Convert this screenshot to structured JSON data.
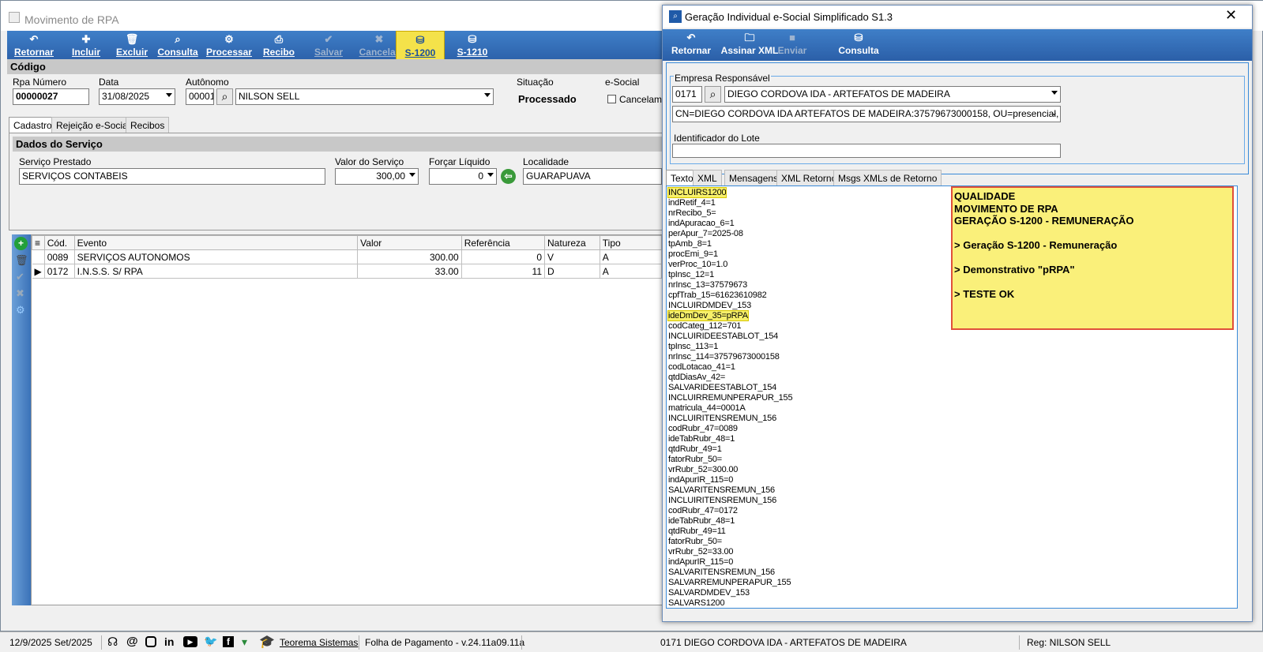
{
  "main": {
    "title": "Movimento de RPA",
    "toolbar": [
      {
        "label": "Retornar",
        "icon": "↶",
        "state": "enabled"
      },
      {
        "label": "Incluir",
        "icon": "✚",
        "state": "enabled"
      },
      {
        "label": "Excluir",
        "icon": "🗑",
        "state": "enabled"
      },
      {
        "label": "Consulta",
        "icon": "⌕",
        "state": "enabled"
      },
      {
        "label": "Processar",
        "icon": "⚙",
        "state": "enabled"
      },
      {
        "label": "Recibo",
        "icon": "⎙",
        "state": "enabled"
      },
      {
        "label": "Salvar",
        "icon": "✔",
        "state": "disabled"
      },
      {
        "label": "Cancelar",
        "icon": "✖",
        "state": "disabled"
      },
      {
        "label": "S-1200",
        "icon": "⛁",
        "state": "highlighted"
      },
      {
        "label": "S-1210",
        "icon": "⛁",
        "state": "enabled"
      }
    ],
    "codigo_section": "Código",
    "rpa_numero_label": "Rpa Número",
    "rpa_numero": "00000027",
    "data_label": "Data",
    "data": "31/08/2025",
    "autonomo_label": "Autônomo",
    "autonomo_code": "00001",
    "autonomo_name": "NILSON SELL",
    "situacao_label": "Situação",
    "situacao": "Processado",
    "esocial_label": "e-Social",
    "cancelamento_label": "Cancelame",
    "tabs": [
      "Cadastro",
      "Rejeição e-Social",
      "Recibos"
    ],
    "servico_section": "Dados do Serviço",
    "servico_label": "Serviço Prestado",
    "servico": "SERVIÇOS CONTABEIS",
    "valor_label": "Valor do Serviço",
    "valor": "300,00",
    "forcar_label": "Forçar Líquido",
    "forcar": "0",
    "localidade_label": "Localidade",
    "localidade": "GUARAPUAVA",
    "grid_headers": [
      "Cód.",
      "Evento",
      "Valor",
      "Referência",
      "Natureza",
      "Tipo"
    ],
    "grid_rows": [
      {
        "cod": "0089",
        "evento": "SERVIÇOS AUTONOMOS",
        "valor": "300.00",
        "ref": "0",
        "nat": "V",
        "tipo": "A"
      },
      {
        "cod": "0172",
        "evento": "I.N.S.S. S/ RPA",
        "valor": "33.00",
        "ref": "11",
        "nat": "D",
        "tipo": "A"
      }
    ]
  },
  "dialog": {
    "title": "Geração Individual e-Social Simplificado S1.3",
    "toolbar": [
      {
        "label": "Retornar",
        "state": "enabled"
      },
      {
        "label": "Assinar XML",
        "state": "enabled"
      },
      {
        "label": "Enviar",
        "state": "disabled"
      },
      {
        "label": "Consulta",
        "state": "enabled"
      }
    ],
    "empresa_label": "Empresa Responsável",
    "empresa_code": "0171",
    "empresa_name": "DIEGO CORDOVA IDA - ARTEFATOS DE MADEIRA",
    "certificado": "CN=DIEGO CORDOVA IDA ARTEFATOS DE MADEIRA:37579673000158, OU=presencial, O=ICP-Br",
    "lote_label": "Identificador do Lote",
    "lote": "",
    "tabs": [
      "Texto",
      "XML",
      "Mensagens",
      "XML Retorno",
      "Msgs XMLs de Retorno"
    ],
    "text_lines": [
      "INCLUIRS1200",
      "indRetif_4=1",
      "nrRecibo_5=",
      "indApuracao_6=1",
      "perApur_7=2025-08",
      "tpAmb_8=1",
      "procEmi_9=1",
      "verProc_10=1.0",
      "tpInsc_12=1",
      "nrInsc_13=37579673",
      "cpfTrab_15=61623610982",
      "INCLUIRDMDEV_153",
      "ideDmDev_35=pRPA",
      "codCateg_112=701",
      "INCLUIRIDEESTABLOT_154",
      "tpInsc_113=1",
      "nrInsc_114=37579673000158",
      "codLotacao_41=1",
      "qtdDiasAv_42=",
      "SALVARIDEESTABLOT_154",
      "INCLUIRREMUNPERAPUR_155",
      "matricula_44=0001A",
      "INCLUIRITENSREMUN_156",
      "codRubr_47=0089",
      "ideTabRubr_48=1",
      "qtdRubr_49=1",
      "fatorRubr_50=",
      "vrRubr_52=300.00",
      "indApurIR_115=0",
      "SALVARITENSREMUN_156",
      "INCLUIRITENSREMUN_156",
      "codRubr_47=0172",
      "ideTabRubr_48=1",
      "qtdRubr_49=11",
      "fatorRubr_50=",
      "vrRubr_52=33.00",
      "indApurIR_115=0",
      "SALVARITENSREMUN_156",
      "SALVARREMUNPERAPUR_155",
      "SALVARDMDEV_153",
      "SALVARS1200"
    ],
    "note_lines": [
      "QUALIDADE",
      "MOVIMENTO DE RPA",
      "GERAÇÃO S-1200 - REMUNERAÇÃO",
      "",
      "> Geração S-1200 - Remuneração",
      "",
      "> Demonstrativo \"pRPA\"",
      "",
      "> TESTE OK"
    ]
  },
  "status": {
    "date": "12/9/2025 Set/2025",
    "company_link": "Teorema Sistemas",
    "version": "Folha de Pagamento - v.24.11a09.11a",
    "empresa": "0171 DIEGO CORDOVA IDA - ARTEFATOS DE MADEIRA",
    "reg": "Reg: NILSON SELL"
  },
  "colors": {
    "toolbar": "#2f68b4",
    "highlight": "#f4e24a",
    "note_bg": "#faf07a",
    "note_border": "#e0503a"
  }
}
